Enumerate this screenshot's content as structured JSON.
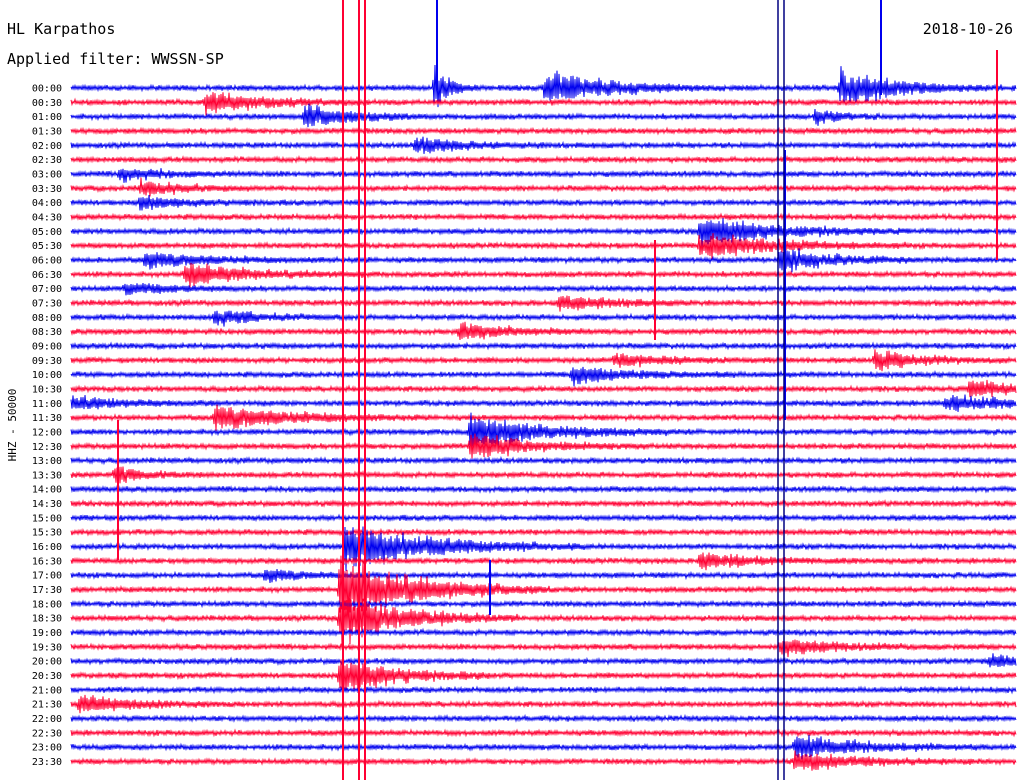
{
  "header": {
    "station": "HL Karpathos",
    "filter_label": "Applied filter: WWSSN-SP",
    "date": "2018-10-26"
  },
  "chart_data": {
    "type": "helicorder",
    "title": "HL Karpathos",
    "subtitle": "Applied filter: WWSSN-SP",
    "date": "2018-10-26",
    "ylabel": "HHZ - 50000",
    "trace_colors": [
      "#0000ee",
      "#ff0033"
    ],
    "marker_color": "#000080",
    "row_labels": [
      "00:00",
      "00:30",
      "01:00",
      "01:30",
      "02:00",
      "02:30",
      "03:00",
      "03:30",
      "04:00",
      "04:30",
      "05:00",
      "05:30",
      "06:00",
      "06:30",
      "07:00",
      "07:30",
      "08:00",
      "08:30",
      "09:00",
      "09:30",
      "10:00",
      "10:30",
      "11:00",
      "11:30",
      "12:00",
      "12:30",
      "13:00",
      "13:30",
      "14:00",
      "14:30",
      "15:00",
      "15:30",
      "16:00",
      "16:30",
      "17:00",
      "17:30",
      "18:00",
      "18:30",
      "19:00",
      "19:30",
      "20:00",
      "20:30",
      "21:00",
      "21:30",
      "22:00",
      "22:30",
      "23:00",
      "23:30"
    ]
  }
}
